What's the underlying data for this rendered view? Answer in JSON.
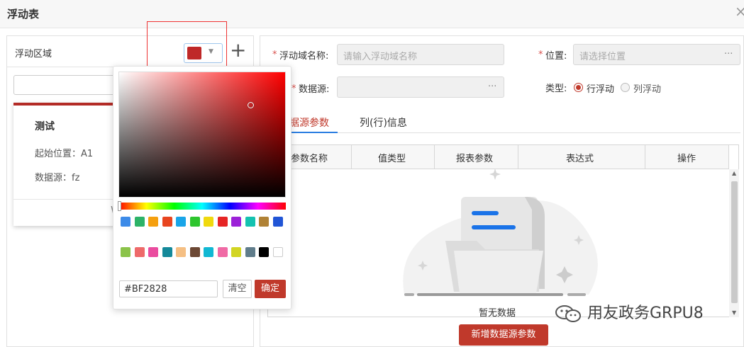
{
  "dialog": {
    "title": "浮动表",
    "close_icon": "close-icon"
  },
  "left": {
    "title": "浮动区域",
    "color_button": {
      "color": "#BF2828",
      "icon": "chevron-down-icon"
    },
    "add_icon": "plus-icon",
    "card": {
      "name": "测试",
      "start_pos": "起始位置：A1",
      "data_source": "数据源：fz",
      "footer_partial": "W"
    }
  },
  "color_picker": {
    "hex": "#BF2828",
    "hue_color": "#FF0000",
    "clear_label": "清空",
    "ok_label": "确定",
    "swatches_row1": [
      "#3d8be8",
      "#2db368",
      "#f5a00f",
      "#e8451f",
      "#19a5e8",
      "#2ec52e",
      "#f0d90e",
      "#e62525",
      "#9c22d8",
      "#14c2b0",
      "#b08236",
      "#2155d6"
    ],
    "swatches_row2": [
      "#8bc34a",
      "#ee6a6a",
      "#ea4c9f",
      "#14899a",
      "#f5bf83",
      "#6c4834",
      "#11b8d3",
      "#f06aa5",
      "#d2d523",
      "#607d8b",
      "#000000",
      "#ffffff"
    ]
  },
  "form": {
    "name_label": "浮动域名称:",
    "name_placeholder": "请输入浮动域名称",
    "position_label": "位置:",
    "position_placeholder": "请选择位置",
    "source_label": "数据源:",
    "type_label": "类型:",
    "type_options": [
      "行浮动",
      "列浮动"
    ],
    "type_selected": "行浮动",
    "ellipsis": "···",
    "required_mark": "*"
  },
  "tabs": [
    "据源参数",
    "列(行)信息"
  ],
  "table": {
    "columns": [
      "参数名称",
      "值类型",
      "报表参数",
      "表达式",
      "操作"
    ],
    "empty_text": "暂无数据"
  },
  "add_param_button": "新增数据源参数",
  "watermark": "用友政务GRPU8",
  "colors": {
    "primary": "#C0392B",
    "tab_active": "#2A7DE1"
  }
}
